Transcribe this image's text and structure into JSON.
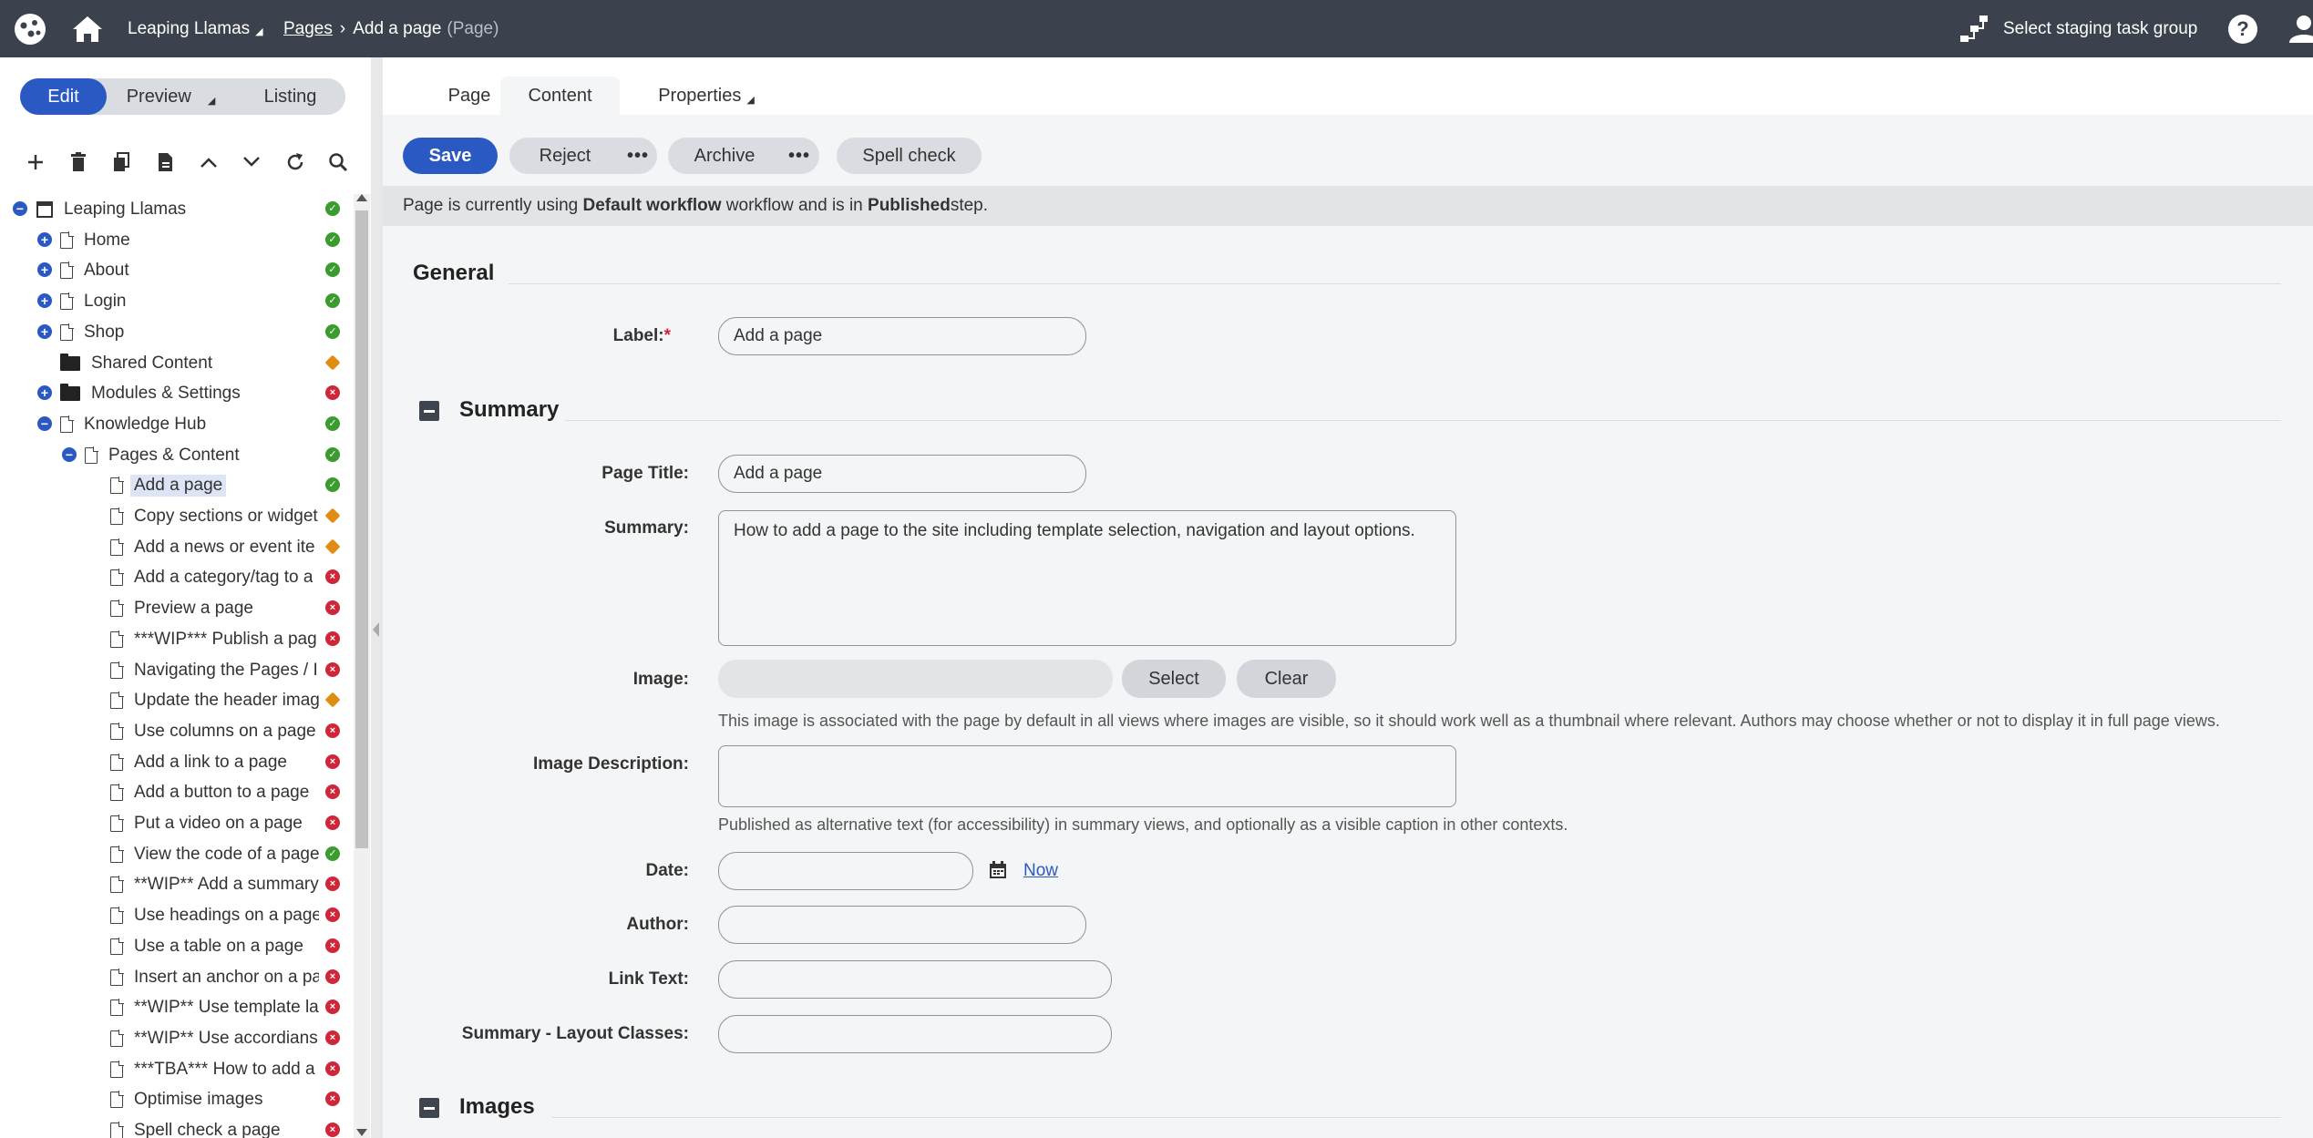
{
  "topbar": {
    "site_name": "Leaping Llamas",
    "site_caret": "◢",
    "breadcrumb_root": "Pages",
    "breadcrumb_sep": "›",
    "page_name": "Add a page",
    "page_type": "(Page)",
    "staging_label": "Select staging task group",
    "help_label": "?",
    "icons": [
      "logo-icon",
      "home-icon",
      "staging-icon",
      "help-icon",
      "user-icon"
    ],
    "bg_color": "#3c424d"
  },
  "view_tabs": {
    "edit": "Edit",
    "preview": "Preview",
    "listing": "Listing"
  },
  "content_tabs": {
    "page": "Page",
    "content": "Content",
    "properties": "Properties"
  },
  "toolbar": {
    "save": "Save",
    "reject": "Reject",
    "archive": "Archive",
    "spell_check": "Spell check",
    "more": "•••"
  },
  "workflow": {
    "prefix": "Page is currently using ",
    "workflow_name": "Default workflow",
    "middle": " workflow and is in ",
    "step": "Published",
    "suffix": " step."
  },
  "tree": {
    "root": "Leaping Llamas",
    "items": [
      {
        "label": "Home",
        "status": "ok"
      },
      {
        "label": "About",
        "status": "ok"
      },
      {
        "label": "Login",
        "status": "ok"
      },
      {
        "label": "Shop",
        "status": "ok"
      },
      {
        "label": "Shared Content",
        "status": "warn"
      },
      {
        "label": "Modules & Settings",
        "status": "err"
      },
      {
        "label": "Knowledge Hub",
        "status": "ok"
      },
      {
        "label": "Pages & Content",
        "status": "ok"
      },
      {
        "label": "Add a page",
        "status": "ok"
      },
      {
        "label": "Copy sections or widget",
        "status": "warn"
      },
      {
        "label": "Add a news or event ite",
        "status": "warn"
      },
      {
        "label": "Add a category/tag to a",
        "status": "err"
      },
      {
        "label": "Preview a page",
        "status": "err"
      },
      {
        "label": "***WIP*** Publish a pag",
        "status": "err"
      },
      {
        "label": "Navigating the Pages / I",
        "status": "err"
      },
      {
        "label": "Update the header imag",
        "status": "warn"
      },
      {
        "label": "Use columns on a page",
        "status": "err"
      },
      {
        "label": "Add a link to a page",
        "status": "err"
      },
      {
        "label": "Add a button to a page",
        "status": "err"
      },
      {
        "label": "Put a video on a page",
        "status": "err"
      },
      {
        "label": "View the code of a page",
        "status": "ok"
      },
      {
        "label": "**WIP** Add a summary",
        "status": "err"
      },
      {
        "label": "Use headings on a page",
        "status": "err"
      },
      {
        "label": "Use a table on a page",
        "status": "err"
      },
      {
        "label": "Insert an anchor on a pa",
        "status": "err"
      },
      {
        "label": "**WIP** Use template la",
        "status": "err"
      },
      {
        "label": "**WIP** Use accordians",
        "status": "err"
      },
      {
        "label": "***TBA*** How to add a",
        "status": "err"
      },
      {
        "label": "Optimise images",
        "status": "err"
      },
      {
        "label": "Spell check a page",
        "status": "err"
      }
    ]
  },
  "form": {
    "general_title": "General",
    "label_label": "Label:",
    "required_mark": "*",
    "label_value": "Add a page",
    "summary_title": "Summary",
    "page_title_label": "Page Title:",
    "page_title_value": "Add a page",
    "summary_label": "Summary:",
    "summary_value": "How to add a page to the site including template selection, navigation and layout options.",
    "image_label": "Image:",
    "image_select": "Select",
    "image_clear": "Clear",
    "image_help": "This image is associated with the page by default in all views where images are visible, so it should work well as a thumbnail where relevant. Authors may choose whether or not to display it in full page views.",
    "image_desc_label": "Image Description:",
    "image_desc_help": "Published as alternative text (for accessibility) in summary views, and optionally as a visible caption in other contexts.",
    "date_label": "Date:",
    "date_now": "Now",
    "author_label": "Author:",
    "link_text_label": "Link Text:",
    "layout_classes_label": "Summary - Layout Classes:",
    "images_title": "Images"
  },
  "colors": {
    "primary": "#2b59c3",
    "ok": "#3a9b2e",
    "error": "#d0263a",
    "warning": "#e08b12"
  }
}
